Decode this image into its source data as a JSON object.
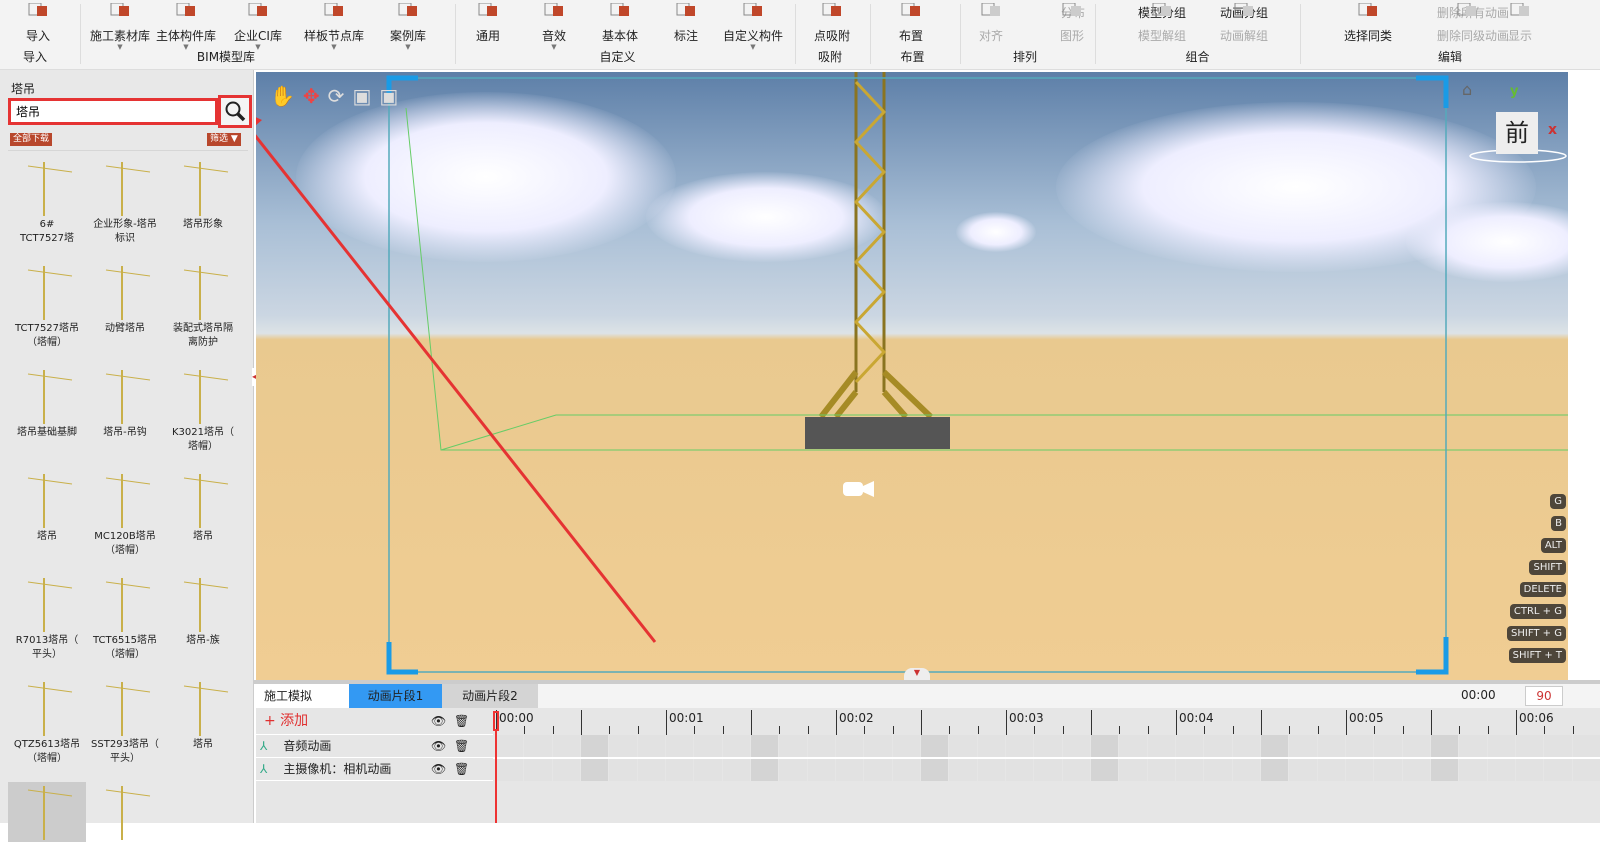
{
  "toolbar": {
    "items": [
      {
        "label": "导入",
        "dropdown": false
      },
      {
        "label": "施工素材库",
        "dropdown": true
      },
      {
        "label": "主体构件库",
        "dropdown": true
      },
      {
        "label": "企业CI库",
        "dropdown": true
      },
      {
        "label": "样板节点库",
        "dropdown": true
      },
      {
        "label": "案例库",
        "dropdown": true
      },
      {
        "label": "通用",
        "dropdown": false
      },
      {
        "label": "音效",
        "dropdown": true
      },
      {
        "label": "基本体",
        "dropdown": false
      },
      {
        "label": "标注",
        "dropdown": false
      },
      {
        "label": "自定义构件",
        "dropdown": true
      },
      {
        "label": "点吸附",
        "dropdown": false
      },
      {
        "label": "布置",
        "dropdown": false
      },
      {
        "label": "对齐",
        "dropdown": false
      },
      {
        "label": "分布",
        "dropdown": false
      },
      {
        "label": "图形",
        "dropdown": false
      },
      {
        "label": "模型分组",
        "dropdown": false
      },
      {
        "label": "动画分组",
        "dropdown": false
      },
      {
        "label": "模型解组",
        "dropdown": false
      },
      {
        "label": "动画解组",
        "dropdown": false
      },
      {
        "label": "选择同类",
        "dropdown": false
      },
      {
        "label": "删除所有动画",
        "dropdown": false
      },
      {
        "label": "删除同级动画",
        "dropdown": false
      },
      {
        "label": "显示",
        "dropdown": false
      }
    ],
    "groups": [
      "导入",
      "BIM模型库",
      "自定义",
      "吸附",
      "布置",
      "排列",
      "组合",
      "编辑"
    ],
    "accent": "#c0472a"
  },
  "sidebar": {
    "title": "塔吊",
    "search_value": "塔吊",
    "download_all": "全部下载",
    "filter": "筛选",
    "items": [
      "6#\nTCT7527塔",
      "企业形象-塔吊\n标识",
      "塔吊形象",
      "TCT7527塔吊\n（塔帽）",
      "动臂塔吊",
      "装配式塔吊隔\n离防护",
      "塔吊基础基脚",
      "塔吊-吊钩",
      "K3021塔吊（\n塔帽）",
      "塔吊",
      "MC120B塔吊\n（塔帽）",
      "塔吊",
      "R7013塔吊（\n平头）",
      "TCT6515塔吊\n（塔帽）",
      "塔吊-族",
      "QTZ5613塔吊\n（塔帽）",
      "SST293塔吊（\n平头）",
      "塔吊",
      "",
      ""
    ]
  },
  "viewport": {
    "view_label": "前",
    "axis_x": "x",
    "axis_y": "y",
    "shortcuts": [
      "G",
      "B",
      "ALT",
      "SHIFT",
      "DELETE",
      "CTRL + G",
      "SHIFT + G",
      "SHIFT + T"
    ]
  },
  "timeline": {
    "tabs": [
      "施工模拟",
      "动画片段1",
      "动画片段2"
    ],
    "active_tab": 1,
    "add_label": "+ 添加",
    "tracks": [
      "音频动画",
      "主摄像机：相机动画"
    ],
    "current_time": "00:00",
    "duration": "90",
    "ruler": [
      "00:00",
      "00:01",
      "00:02",
      "00:03",
      "00:04",
      "00:05",
      "00:06"
    ]
  }
}
